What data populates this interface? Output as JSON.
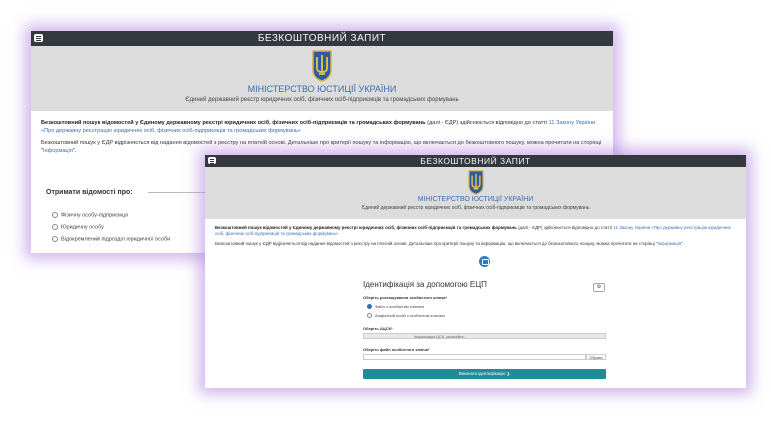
{
  "back_window": {
    "topbar_title": "БЕЗКОШТОВНИЙ ЗАПИТ",
    "ministry": "МІНІСТЕРСТВО ЮСТИЦІЇ УКРАЇНИ",
    "subtitle": "Єдиний державний реєстр юридичних осіб, фізичних осіб-підприємців та громадських формувань",
    "intro_bold": "Безкоштовний пошук відомостей у Єдиному державному реєстрі юридичних осіб, фізичних осіб-підприємців та громадських формувань",
    "intro_rest": " (далі - ЄДР) здійснюється відповідно до статті ",
    "intro_link": "11 Закону України «Про державну реєстрацію юридичних осіб, фізичних осіб-підприємців та громадських формувань»",
    "intro_p2": "Безкоштовний пошук у ЄДР відрізняється від надання відомостей з реєстру на платній основі. Детальніше про критерії пошуку та інформацію, що включається до безкоштовного пошуку, можна прочитати на сторінці \"",
    "intro_p2_link": "Інформація",
    "intro_p2_end": "\".",
    "get_info_label": "Отримати відомості про:",
    "options": [
      "Фізичну особу-підприємця",
      "Юридичну особу",
      "Відокремлений підрозділ юридичної особи"
    ]
  },
  "front_window": {
    "topbar_title": "БЕЗКОШТОВНИЙ ЗАПИТ",
    "ministry": "МІНІСТЕРСТВО ЮСТИЦІЇ УКРАЇНИ",
    "subtitle": "Єдиний державний реєстр юридичних осіб, фізичних осіб-підприємців та громадських формувань",
    "intro_bold": "Безкоштовний пошук відомостей у Єдиному державному реєстрі юридичних осіб, фізичних осіб-підприємців та громадських формувань",
    "intro_rest": " (далі - ЄДР) здійснюється відповідно до статті ",
    "intro_link": "11 Закону України «Про державну реєстрацію юридичних осіб, фізичних осіб-підприємців та громадських формувань»",
    "intro_p2": "Безкоштовний пошук у ЄДР відрізняється від надання відомостей з реєстру на платній основі. Детальніше про критерії пошуку та інформацію, що включається до безкоштовного пошуку, можна прочитати на сторінці \"",
    "intro_p2_link": "Інформація",
    "intro_p2_end": "\".",
    "card_title": "Ідентифікація за допомогою ЕЦП",
    "key_location_label": "Оберіть розташування особистого ключа*",
    "key_options": [
      "Файл з особистим ключем",
      "Апаратний носій з особистим ключем"
    ],
    "acsk_label": "Оберіть АЦСК*",
    "acsk_placeholder": "Ініціалізація ЦСК, зачекайте...",
    "file_label": "Оберіть файл особистого ключа*",
    "browse_label": "Обрати",
    "submit_label": "Виконати ідентифікацію ❯"
  }
}
